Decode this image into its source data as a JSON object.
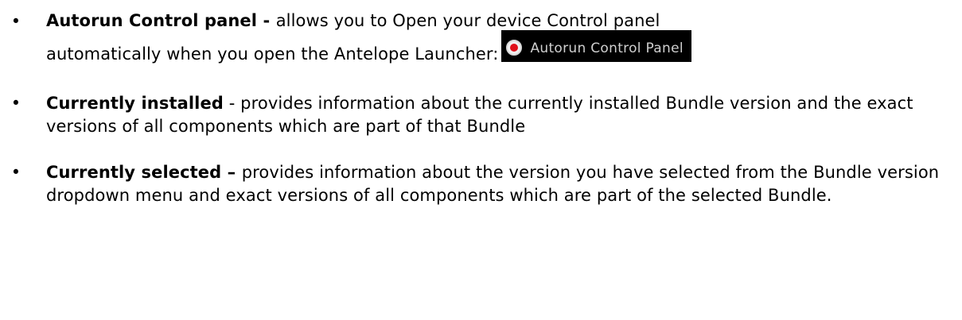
{
  "items": [
    {
      "title": "Autorun Control panel",
      "separator": " - ",
      "text_line1": "allows you to Open your device Control panel",
      "text_line2": "automatically when you open the Antelope Launcher:"
    },
    {
      "title": "Currently installed",
      "separator": " - ",
      "text": "provides information about the currently installed Bundle version and the exact versions of all components which are part of that Bundle"
    },
    {
      "title": "Currently selected",
      "separator": " – ",
      "text": "provides information about the version you have selected from the Bundle version dropdown menu and exact versions of all components which are part of the selected Bundle."
    }
  ],
  "autorun_widget": {
    "label": "Autorun Control Panel",
    "checked": true,
    "accent_color": "#e0101a"
  },
  "bullet_glyph": "•"
}
